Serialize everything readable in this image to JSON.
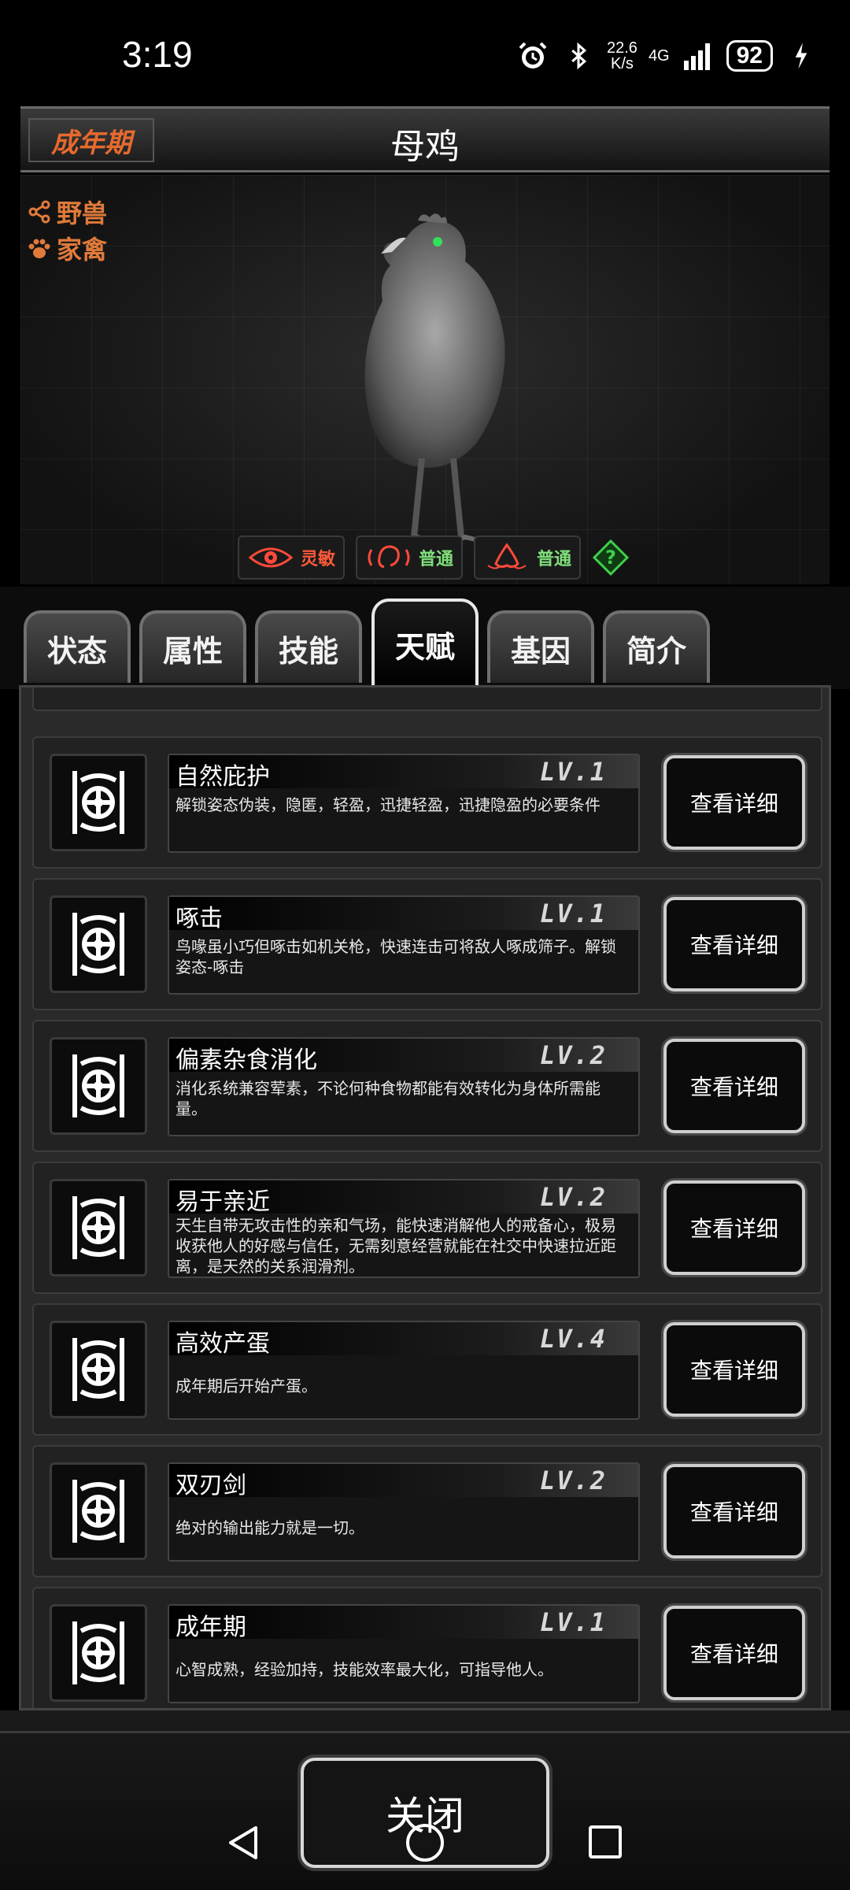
{
  "status_bar": {
    "time": "3:19",
    "speed_value": "22.6",
    "speed_unit": "K/s",
    "network": "4G",
    "battery": "92"
  },
  "header": {
    "stage": "成年期",
    "name": "母鸡"
  },
  "tags": [
    {
      "icon": "share-icon",
      "label": "野兽"
    },
    {
      "icon": "paw-icon",
      "label": "家禽"
    }
  ],
  "senses": [
    {
      "icon": "eye-icon",
      "label": "灵敏",
      "color": "#ff5a3a"
    },
    {
      "icon": "ear-icon",
      "label": "普通",
      "color": "#7fe07a"
    },
    {
      "icon": "nose-icon",
      "label": "普通",
      "color": "#7fe07a"
    }
  ],
  "tabs": [
    "状态",
    "属性",
    "技能",
    "天赋",
    "基因",
    "简介"
  ],
  "active_tab": "天赋",
  "talents": [
    {
      "name": "自然庇护",
      "level": "LV.1",
      "desc": "解锁姿态伪装，隐匿，轻盈，迅捷轻盈，迅捷隐盈的必要条件",
      "button": "查看详细"
    },
    {
      "name": "啄击",
      "level": "LV.1",
      "desc": "鸟喙虽小巧但啄击如机关枪，快速连击可将敌人啄成筛子。解锁姿态-啄击",
      "button": "查看详细"
    },
    {
      "name": "偏素杂食消化",
      "level": "LV.2",
      "desc": "消化系统兼容荤素，不论何种食物都能有效转化为身体所需能量。",
      "button": "查看详细"
    },
    {
      "name": "易于亲近",
      "level": "LV.2",
      "desc": "天生自带无攻击性的亲和气场，能快速消解他人的戒备心，极易收获他人的好感与信任，无需刻意经营就能在社交中快速拉近距离，是天然的关系润滑剂。",
      "button": "查看详细"
    },
    {
      "name": "高效产蛋",
      "level": "LV.4",
      "desc": "成年期后开始产蛋。",
      "button": "查看详细"
    },
    {
      "name": "双刃剑",
      "level": "LV.2",
      "desc": "绝对的输出能力就是一切。",
      "button": "查看详细"
    },
    {
      "name": "成年期",
      "level": "LV.1",
      "desc": "心智成熟，经验加持，技能效率最大化，可指导他人。",
      "button": "查看详细"
    }
  ],
  "close_label": "关闭"
}
